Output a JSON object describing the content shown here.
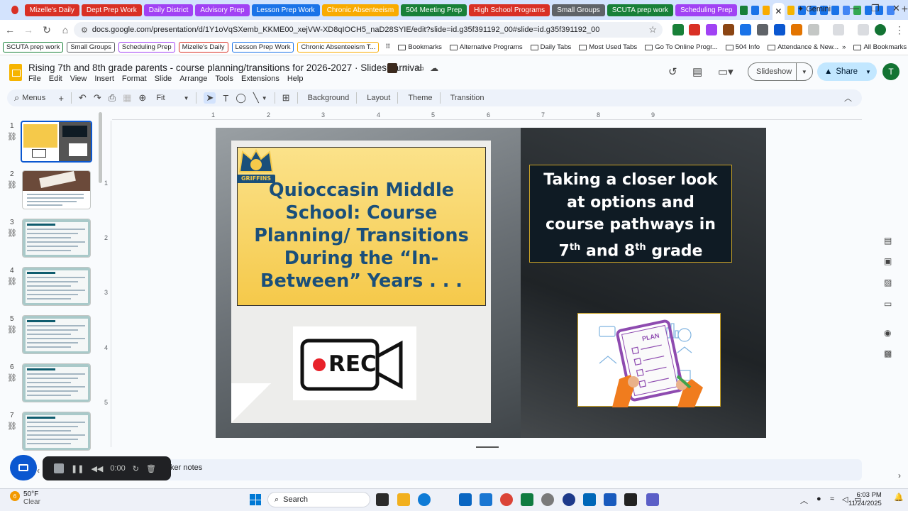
{
  "browser": {
    "tabs": [
      {
        "label": "Mizelle's Daily",
        "color": "#d93025"
      },
      {
        "label": "Dept Prep Work",
        "color": "#d93025"
      },
      {
        "label": "Daily District",
        "color": "#a142f4"
      },
      {
        "label": "Advisory Prep",
        "color": "#a142f4"
      },
      {
        "label": "Lesson Prep Work",
        "color": "#1a73e8"
      },
      {
        "label": "Chronic Absenteeism",
        "color": "#f9ab00"
      },
      {
        "label": "504 Meeting Prep",
        "color": "#188038"
      },
      {
        "label": "High School Programs",
        "color": "#d93025"
      },
      {
        "label": "Small Groups",
        "color": "#5f6368"
      },
      {
        "label": "SCUTA prep work",
        "color": "#188038"
      },
      {
        "label": "Scheduling Prep",
        "color": "#a142f4"
      }
    ],
    "active_tab_close": "✕",
    "new_tab": "+",
    "gemini_label": "Gemini",
    "url": "docs.google.com/presentation/d/1Y1oVqSXemb_KKME00_xejVW-XD8qIOCH5_naD28SYIE/edit?slide=id.g35f391192_00#slide=id.g35f391192_00",
    "bookmarks_chips": [
      {
        "label": "SCUTA prep work",
        "color": "#188038"
      },
      {
        "label": "Small Groups",
        "color": "#5f6368"
      },
      {
        "label": "Scheduling Prep",
        "color": "#a142f4"
      },
      {
        "label": "Mizelle's Daily",
        "color": "#d93025"
      },
      {
        "label": "Lesson Prep Work",
        "color": "#1a73e8"
      },
      {
        "label": "Chronic Absenteeism T...",
        "color": "#f9ab00"
      }
    ],
    "bookmark_folders": [
      "Bookmarks",
      "Alternative Programs",
      "Daily Tabs",
      "Most Used Tabs",
      "Go To Online Progr...",
      "504 Info",
      "Attendance & New..."
    ],
    "all_bookmarks": "All Bookmarks"
  },
  "slides": {
    "title": "Rising 7th and 8th grade parents - course planning/transitions for 2026-2027 · SlidesCarnival",
    "menu": [
      "File",
      "Edit",
      "View",
      "Insert",
      "Format",
      "Slide",
      "Arrange",
      "Tools",
      "Extensions",
      "Help"
    ],
    "slideshow_label": "Slideshow",
    "share_label": "Share",
    "avatar_letter": "T",
    "toolbar": {
      "menus": "Menus",
      "zoom": "Fit",
      "background": "Background",
      "layout": "Layout",
      "theme": "Theme",
      "transition": "Transition"
    },
    "thumbnails": [
      "1",
      "2",
      "3",
      "4",
      "5",
      "6",
      "7"
    ],
    "ruler_h": [
      "1",
      "2",
      "3",
      "4",
      "5",
      "6",
      "7",
      "8",
      "9"
    ],
    "ruler_v": [
      "1",
      "2",
      "3",
      "4",
      "5"
    ],
    "speaker_notes": "ker notes"
  },
  "slide_content": {
    "main_title": "Quioccasin Middle School: Course Planning/ Transitions During the “In-Between” Years . . .",
    "mascot_text": "GRIFFINS",
    "rec_label": "REC",
    "dark_box_lines": [
      "Taking a closer look",
      "at options and",
      "course pathways in"
    ],
    "grade_line": {
      "a": "7",
      "a_sup": "th",
      "and": " and ",
      "b": "8",
      "b_sup": "th",
      "grade": " grade"
    },
    "plan_label": "PLAN"
  },
  "recorder": {
    "time": "0:00"
  },
  "taskbar": {
    "temp": "50°F",
    "condition": "Clear",
    "weather_badge": "6",
    "search": "Search",
    "time": "6:03 PM",
    "date": "11/24/2025"
  }
}
